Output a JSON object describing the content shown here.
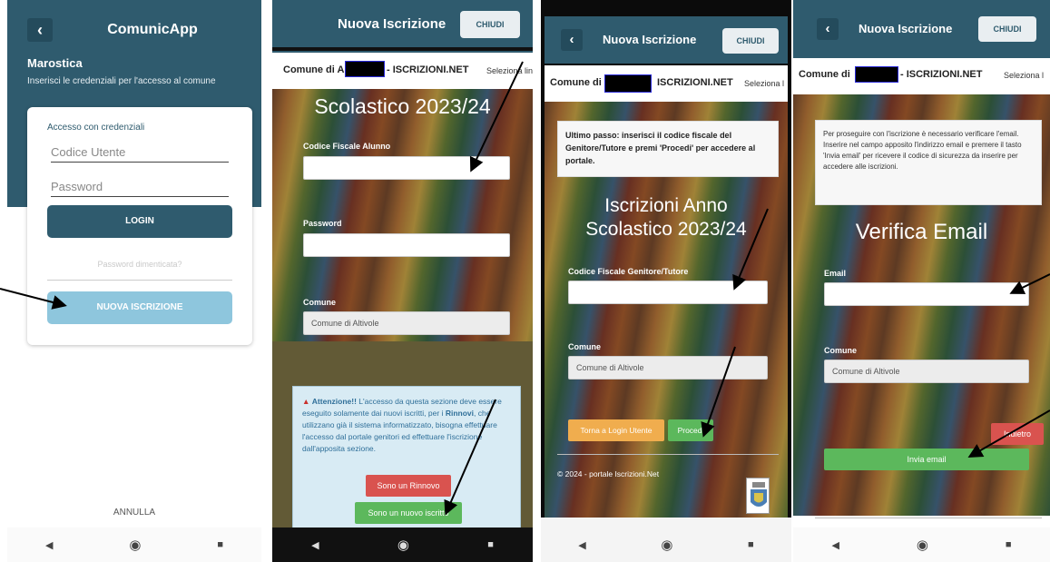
{
  "screen1": {
    "app_title": "ComunicApp",
    "city": "Marostica",
    "subtitle": "Inserisci le credenziali per l'accesso al comune",
    "card_label": "Accesso con credenziali",
    "user_placeholder": "Codice Utente",
    "password_placeholder": "Password",
    "login_label": "LOGIN",
    "forgot_label": "Password dimenticata?",
    "new_registration_label": "NUOVA ISCRIZIONE",
    "cancel_label": "ANNULLA"
  },
  "screen2": {
    "title": "Nuova Iscrizione",
    "close_label": "CHIUDI",
    "comune_prefix": "Comune di A",
    "portal_name": "- ISCRIZIONI.NET",
    "select_label": "Seleziona lin",
    "heading": "Scolastico 2023/24",
    "field_codice_label": "Codice Fiscale Alunno",
    "field_password_label": "Password",
    "field_comune_label": "Comune",
    "comune_value": "Comune di Altivole",
    "warning_title": "Attenzione!!",
    "warning_text_1": "L'accesso da questa sezione deve essere eseguito solamente dai nuovi iscritti, per i",
    "warning_bold": "Rinnovi",
    "warning_text_2": ", che utilizzano già il sistema informatizzato, bisogna effettuare l'accesso dal portale genitori ed effettuare l'iscrizione dall'apposita sezione.",
    "btn_rinnovo": "Sono un Rinnovo",
    "btn_nuovo": "Sono un nuovo iscritto"
  },
  "screen3": {
    "title": "Nuova Iscrizione",
    "close_label": "CHIUDI",
    "comune_prefix": "Comune di",
    "portal_name": "ISCRIZIONI.NET",
    "select_label": "Seleziona l",
    "note": "Ultimo passo: inserisci il codice fiscale del Genitore/Tutore e premi 'Procedi' per accedere al portale.",
    "heading_line1": "Iscrizioni Anno",
    "heading_line2": "Scolastico 2023/24",
    "field_codice_label": "Codice Fiscale Genitore/Tutore",
    "field_comune_label": "Comune",
    "comune_value": "Comune di Altivole",
    "btn_torna": "Torna a Login Utente",
    "btn_procedi": "Procedi",
    "footer": "© 2024 - portale Iscrizioni.Net"
  },
  "screen4": {
    "title": "Nuova Iscrizione",
    "close_label": "CHIUDI",
    "comune_prefix": "Comune di",
    "portal_name": "- ISCRIZIONI.NET",
    "select_label": "Seleziona l",
    "note": "Per proseguire con l'iscrizione è necessario verificare l'email. Inserire nel campo apposito l'indirizzo email e premere il tasto 'Invia email' per ricevere il codice di sicurezza da inserire per accedere alle iscrizioni.",
    "heading": "Verifica Email",
    "field_email_label": "Email",
    "field_comune_label": "Comune",
    "comune_value": "Comune di Altivole",
    "btn_indietro": "Indietro",
    "btn_invia": "Invia email"
  },
  "nav_icons": [
    "back-triangle-icon",
    "home-circle-icon",
    "recents-square-icon"
  ],
  "colors": {
    "header_teal": "#2f5b6e",
    "button_light_blue": "#8ec6dd",
    "button_green": "#5cb85c",
    "button_red": "#d9534f",
    "button_orange": "#f0ad4e"
  }
}
